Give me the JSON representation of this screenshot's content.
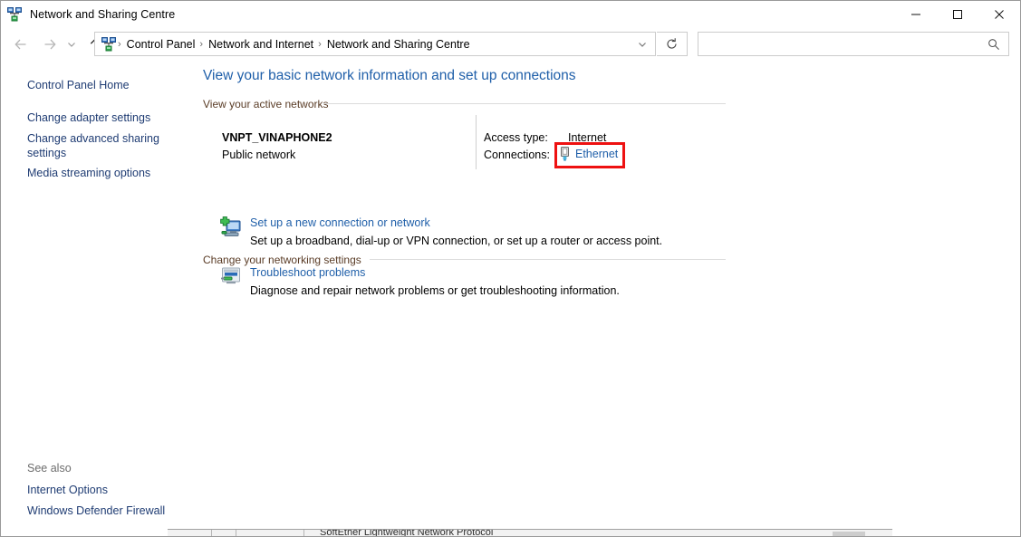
{
  "window": {
    "title": "Network and Sharing Centre",
    "icon": "network-sharing-icon",
    "controls": {
      "minimize": "minimize-button",
      "maximize": "maximize-button",
      "close": "close-button"
    }
  },
  "navigation": {
    "back": "back-arrow",
    "forward": "forward-arrow",
    "recent": "recent-locations-chevron",
    "up": "up-arrow",
    "breadcrumbs": [
      "Control Panel",
      "Network and Internet",
      "Network and Sharing Centre"
    ],
    "separator": "›",
    "dropdown": "address-dropdown-chevron",
    "refresh": "refresh-icon"
  },
  "search": {
    "value": "",
    "placeholder": "",
    "icon": "search-icon"
  },
  "sidebar": {
    "home": "Control Panel Home",
    "links": [
      "Change adapter settings",
      "Change advanced sharing settings",
      "Media streaming options"
    ],
    "see_also_label": "See also",
    "see_also": [
      "Internet Options",
      "Windows Defender Firewall"
    ]
  },
  "main": {
    "page_title": "View your basic network information and set up connections",
    "sections": {
      "active_networks": {
        "heading": "View your active networks",
        "network_name": "VNPT_VINAPHONE2",
        "network_type": "Public network",
        "access_type_label": "Access type:",
        "access_type_value": "Internet",
        "connections_label": "Connections:",
        "connection_name": "Ethernet",
        "connection_icon": "ethernet-connector-icon",
        "highlight_color": "#ee1111"
      },
      "networking_settings": {
        "heading": "Change your networking settings",
        "tasks": [
          {
            "link": "Set up a new connection or network",
            "description": "Set up a broadband, dial-up or VPN connection, or set up a router or access point.",
            "icon": "new-connection-icon"
          },
          {
            "link": "Troubleshoot problems",
            "description": "Diagnose and repair network problems or get troubleshooting information.",
            "icon": "troubleshoot-icon"
          }
        ]
      }
    }
  },
  "background_window": {
    "partial_text": "SoftEther Lightweight Network Protocol"
  },
  "colors": {
    "link": "#1f5fa9",
    "sidebar_link": "#1f3c73",
    "section_heading": "#5a3c26",
    "highlight": "#ee1111"
  }
}
